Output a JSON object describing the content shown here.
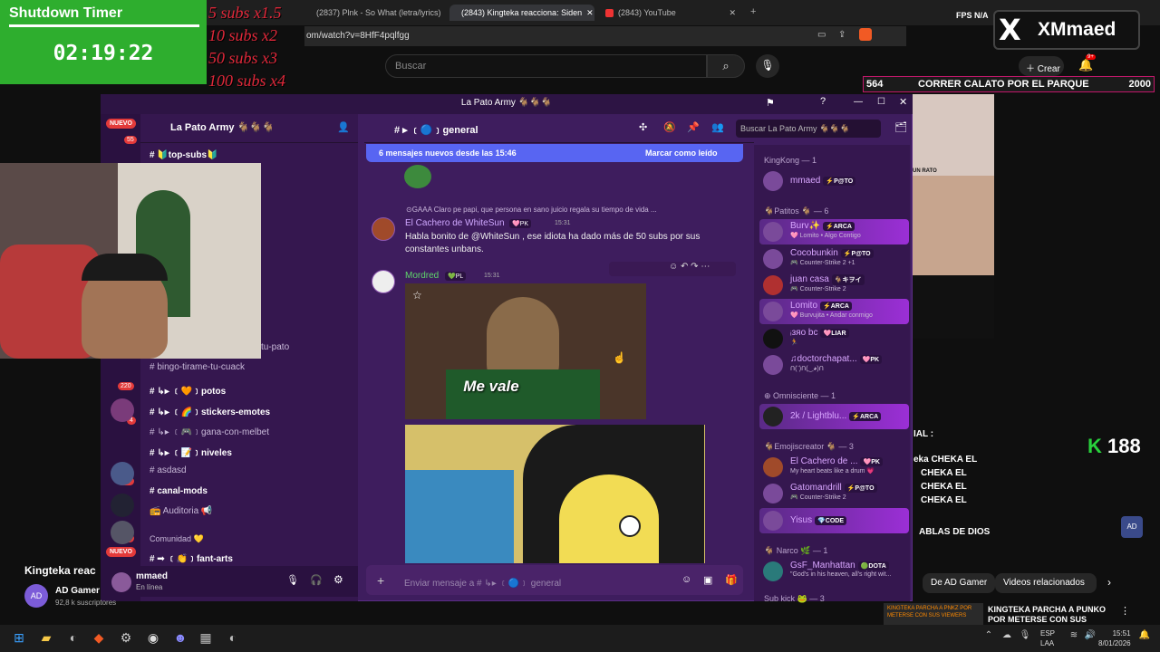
{
  "browser": {
    "tabs": [
      {
        "label": "(2837) Plnk - So What (letra/lyrics) -"
      },
      {
        "label": "(2843) Kingteka reacciona: Siden"
      },
      {
        "label": "(2843) YouTube"
      }
    ],
    "url": "om/watch?v=8HfF4pqlfgg",
    "search_placeholder": "Buscar",
    "create_label": "Crear",
    "notif_badge": "9+",
    "fps_label": "FPS",
    "fps_value": "N/A"
  },
  "overlay": {
    "timer_title": "Shutdown Timer",
    "timer_value": "02:19:22",
    "sub_rules": [
      "5 subs x1.5",
      "10 subs x2",
      "50 subs x3",
      "100 subs x4"
    ],
    "x_logo": "X",
    "x_name": "XMmaed",
    "goal_current": "564",
    "goal_text": "CORRER CALATO POR EL PARQUE",
    "goal_target": "2000",
    "k_count": "188",
    "k_glyph": "K"
  },
  "discord": {
    "window_title": "La Pato Army 🐐🐐🐐",
    "server_name": "La Pato Army 🐐🐐🐐",
    "new_badge": "NUEVO",
    "server_badges": [
      "55",
      "44",
      "220",
      "4",
      "150",
      "608"
    ],
    "channel_header": "#  ▸ ﹝🔵﹞general",
    "search_placeholder": "Buscar La Pato Army 🐐🐐🐐",
    "new_messages": "6 mensajes nuevos desde las 15:46",
    "mark_read": "Marcar como leído",
    "channels": [
      {
        "name": "# 🔰top-subs🔰",
        "bold": true
      },
      {
        "name": "tu-pato",
        "bold": false
      },
      {
        "name": "# bingo-tirame-tu-cuack",
        "bold": false
      },
      {
        "name": "#  ↳▸ ﹝🧡﹞potos",
        "bold": true
      },
      {
        "name": "#  ↳▸ ﹝🌈﹞stickers-emotes",
        "bold": true
      },
      {
        "name": "#  ↳▸ ﹝🎮﹞gana-con-melbet",
        "bold": false
      },
      {
        "name": "#  ↳▸ ﹝📝﹞niveles",
        "bold": true
      },
      {
        "name": "# asdasd",
        "bold": false
      },
      {
        "name": "# canal-mods",
        "bold": true
      },
      {
        "name": "📻 Auditoria 📢",
        "bold": false
      },
      {
        "name": "Comunidad 💛",
        "bold": false
      },
      {
        "name": "# ➟ ﹝👏﹞fant-arts",
        "bold": true
      }
    ],
    "messages": {
      "reply_preview": "⊙GAAA  Claro pe papi, que persona en sano juicio regala su tiempo de vida ...",
      "author1": "El Cachero de WhiteSun",
      "author1_tag": "🩷PK",
      "author1_time": "15:31",
      "text1": "Habla bonito de @WhiteSun , ese idiota ha dado más de 50 subs por sus constantes unbans.",
      "author2": "Mordred",
      "author2_tag": "💚PL",
      "author2_time": "15:31",
      "gif_caption": "Me vale"
    },
    "composer_placeholder": "Enviar mensaje a #  ↳▸ ﹝🔵﹞ general",
    "user_name": "mmaed",
    "user_status": "En línea",
    "member_groups": [
      {
        "header": "KingKong — 1"
      },
      {
        "header": "🐐Patitos 🐐 — 6"
      },
      {
        "header": "⊕ Omnisciente — 1"
      },
      {
        "header": "🐐Emojiscreator 🐐 — 3"
      },
      {
        "header": "🐐 Narco 🌿 — 1"
      },
      {
        "header": "Sub kick 🐸 — 3"
      }
    ],
    "members": [
      {
        "name": "mmaed",
        "tag": "⚡P@TO",
        "status": "",
        "hl": false
      },
      {
        "name": "Burv✨",
        "tag": "⚡ARCA",
        "status": "🩷 Lomito • Algo Contigo",
        "hl": true
      },
      {
        "name": "Cocobunkin",
        "tag": "⚡P@TO",
        "status": "🎮 Counter-Strike 2 +1",
        "hl": false
      },
      {
        "name": "juan casa",
        "tag": "🐐キヲイ",
        "status": "🎮 Counter-Strike 2",
        "hl": false
      },
      {
        "name": "Lomito",
        "tag": "⚡ARCA",
        "status": "🩷 Burvujita • Andar conmigo",
        "hl": true
      },
      {
        "name": "ᵢзяο bc",
        "tag": "🩷LIAR",
        "status": "🏃",
        "hl": false
      },
      {
        "name": "♫doctorchapat...",
        "tag": "🩷PK",
        "status": "ᑎ(¨)ᑎ(‿◕)ᑎ",
        "hl": false
      },
      {
        "name": "2k / Lightblu...",
        "tag": "⚡ARCA",
        "status": "",
        "hl": true
      },
      {
        "name": "El Cachero de ...",
        "tag": "🩷PK",
        "status": "My heart beats like a drum 💗",
        "hl": false
      },
      {
        "name": "Gatomandrill",
        "tag": "⚡P@TO",
        "status": "🎮 Counter-Strike 2",
        "hl": false
      },
      {
        "name": "Yisus",
        "tag": "💎CODE",
        "status": "",
        "hl": true
      },
      {
        "name": "GsF_Manhattan",
        "tag": "🟢DOTA",
        "status": "\"God's in his heaven, all's right wit...",
        "hl": false
      }
    ]
  },
  "stream": {
    "chat_label": "IAL :",
    "chat_lines": [
      "eka CHEKA EL",
      "CHEKA EL",
      "CHEKA EL",
      "CHEKA EL"
    ],
    "chat_bottom": "ABLAS DE DIOS",
    "cam_label": "UN RATO"
  },
  "youtube": {
    "video_title": "Kingteka reac",
    "channel": "AD Gamer",
    "channel_avatar": "AD",
    "subs": "92,8 k suscriptores",
    "chips": [
      "De AD Gamer",
      "Videos relacionados"
    ],
    "side_title": "KINGTEKA PARCHA A PUNKO POR METERSE CON SUS",
    "thumb_text": "KINGTEKA PARCHA A PNKZ POR METERSE CON SUS VIEWERS"
  },
  "taskbar": {
    "lang_top": "ESP",
    "lang_bottom": "LAA",
    "time": "15:51",
    "date": "8/01/2026"
  }
}
